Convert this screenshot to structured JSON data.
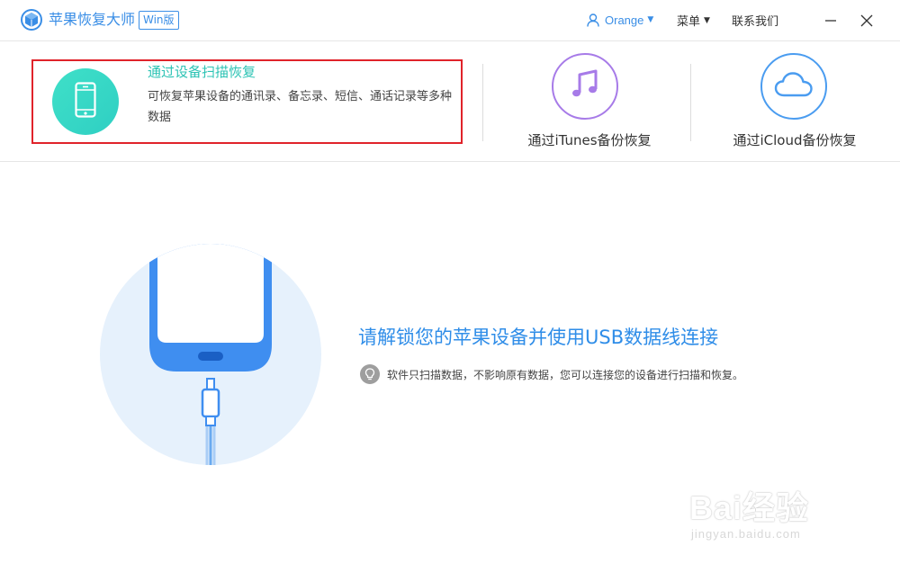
{
  "app": {
    "title": "苹果恢复大师",
    "edition_badge": "Win版",
    "icon": "app-cube-icon"
  },
  "header": {
    "user_name": "Orange",
    "menu_label": "菜单",
    "contact_label": "联系我们",
    "icons": [
      "user-icon",
      "caret-down-icon",
      "minimize-icon",
      "close-icon"
    ]
  },
  "modes": {
    "device": {
      "title": "通过设备扫描恢复",
      "description": "可恢复苹果设备的通讯录、备忘录、短信、通话记录等多种数据",
      "icon": "phone-icon",
      "selected": true
    },
    "itunes": {
      "label": "通过iTunes备份恢复",
      "icon": "music-note-icon"
    },
    "icloud": {
      "label": "通过iCloud备份恢复",
      "icon": "cloud-icon"
    }
  },
  "main": {
    "heading": "请解锁您的苹果设备并使用USB数据线连接",
    "tip": "软件只扫描数据，不影响原有数据，您可以连接您的设备进行扫描和恢复。",
    "tip_icon": "lightbulb-icon",
    "illustration": "phone-usb-cable-illustration"
  },
  "watermark": {
    "brand": "Bai经验",
    "url": "jingyan.baidu.com"
  },
  "colors": {
    "accent_blue": "#3a8ee6",
    "teal": "#2cc3b4",
    "purple": "#a77be8",
    "selection_red": "#e0232a"
  }
}
